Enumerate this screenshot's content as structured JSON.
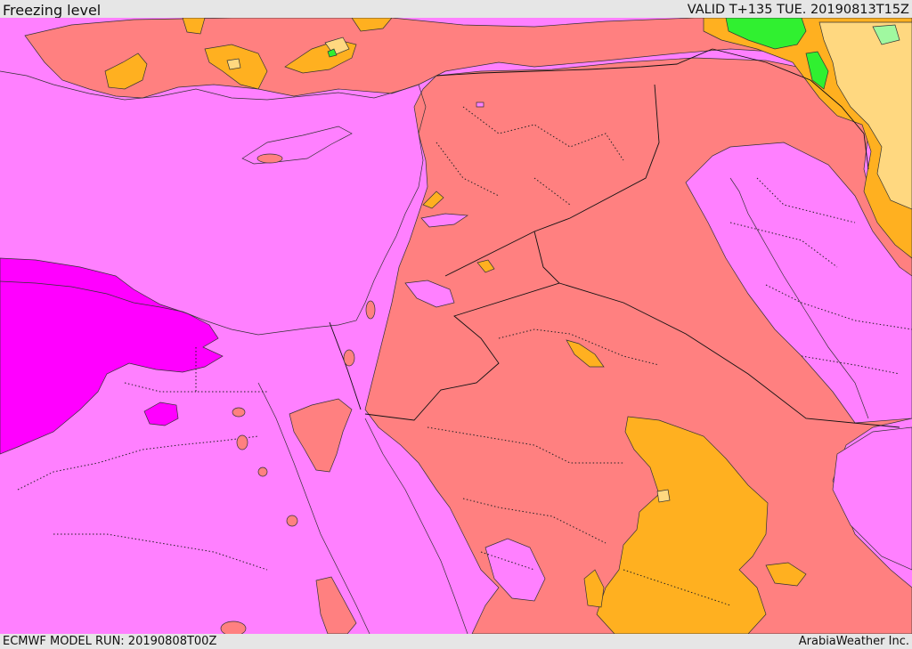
{
  "header": {
    "title": "Freezing level",
    "valid": "VALID T+135 TUE. 20190813T15Z"
  },
  "footer": {
    "model_run": "ECMWF MODEL RUN: 20190808T00Z",
    "credit": "ArabiaWeather Inc."
  },
  "palette": {
    "magenta": "#ff80ff",
    "deep_magenta": "#ff00ff",
    "salmon": "#ff8080",
    "orange": "#ffb020",
    "light_orange": "#ffd880",
    "green": "#30f030",
    "light_green": "#a0f8a0"
  }
}
